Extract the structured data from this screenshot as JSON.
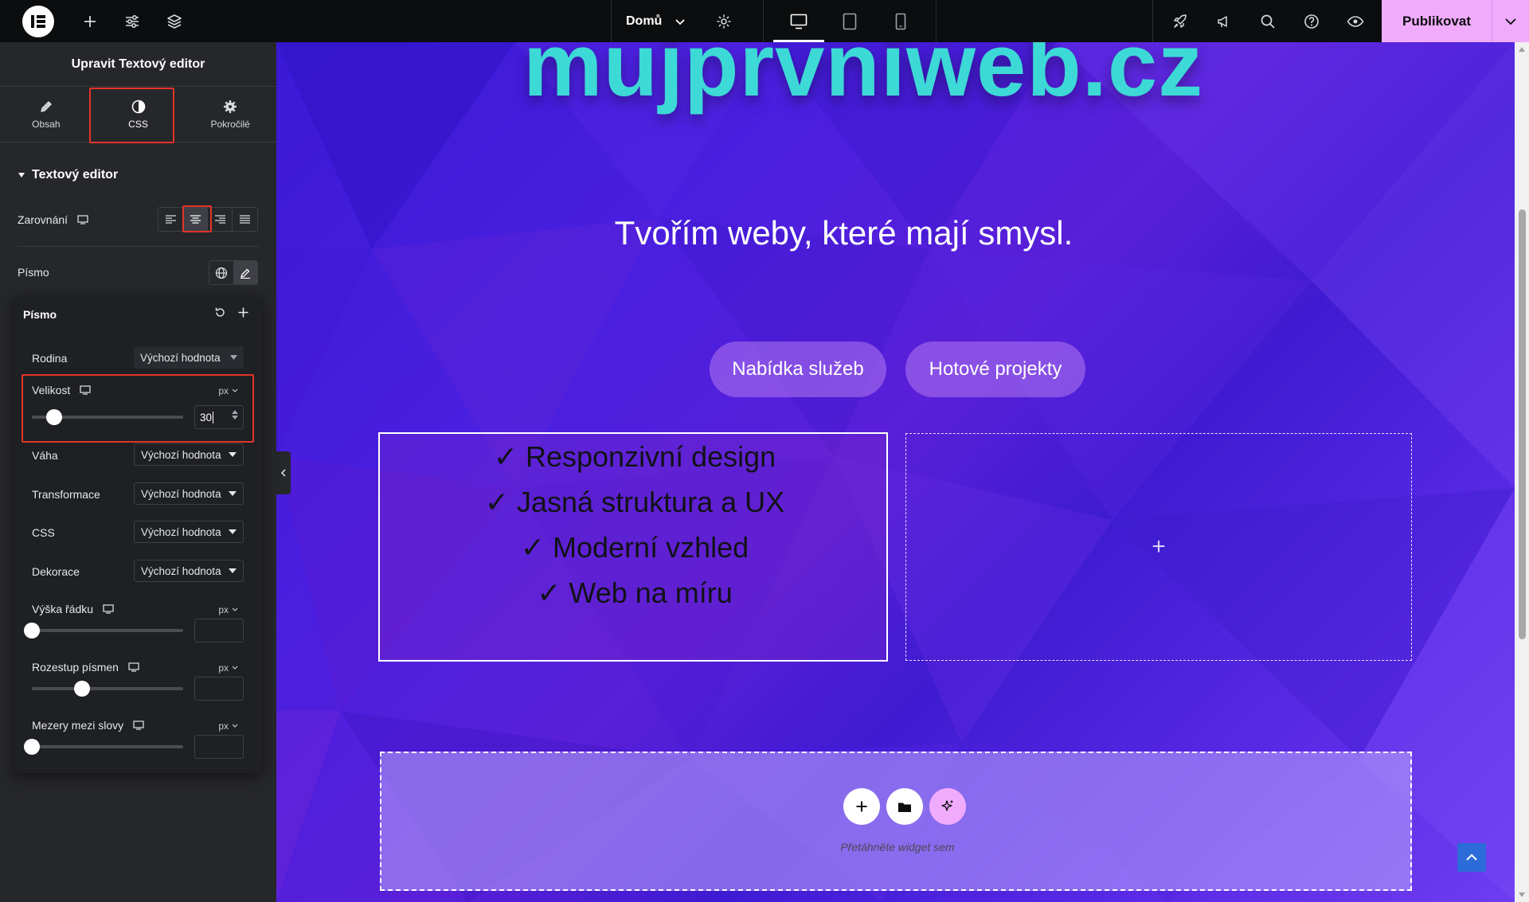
{
  "topbar": {
    "page_name": "Domů",
    "publish_label": "Publikovat"
  },
  "panel": {
    "title": "Upravit Textový editor",
    "tabs": [
      {
        "label": "Obsah"
      },
      {
        "label": "CSS"
      },
      {
        "label": "Pokročilé"
      }
    ],
    "section_title": "Textový editor",
    "alignment_label": "Zarovnání",
    "font_label": "Písmo"
  },
  "typography": {
    "title": "Písmo",
    "family_label": "Rodina",
    "family_value": "Výchozí hodnota",
    "size_label": "Velikost",
    "size_unit": "px",
    "size_value": "30",
    "weight_label": "Váha",
    "weight_value": "Výchozí hodnota",
    "transform_label": "Transformace",
    "transform_value": "Výchozí hodnota",
    "style_label": "CSS",
    "style_value": "Výchozí hodnota",
    "decoration_label": "Dekorace",
    "decoration_value": "Výchozí hodnota",
    "line_height_label": "Výška řádku",
    "line_height_unit": "px",
    "letter_spacing_label": "Rozestup písmen",
    "letter_spacing_unit": "px",
    "word_spacing_label": "Mezery mezi slovy",
    "word_spacing_unit": "px"
  },
  "canvas": {
    "domain": "mujprvniweb.cz",
    "tagline": "Tvořím weby, které mají smysl.",
    "buttons": [
      "Nabídka služeb",
      "Hotové projekty"
    ],
    "features": [
      "✓ Responzivní design",
      "✓ Jasná struktura a UX",
      "✓ Moderní vzhled",
      "✓ Web na míru"
    ],
    "empty_column_icon": "+",
    "dropzone_text": "Přetáhněte widget sem"
  },
  "colors": {
    "accent": "#f0abfc",
    "highlight": "#e5332a",
    "domain_text": "#3dd9d6",
    "canvas_bg": "#4a1fe0"
  }
}
